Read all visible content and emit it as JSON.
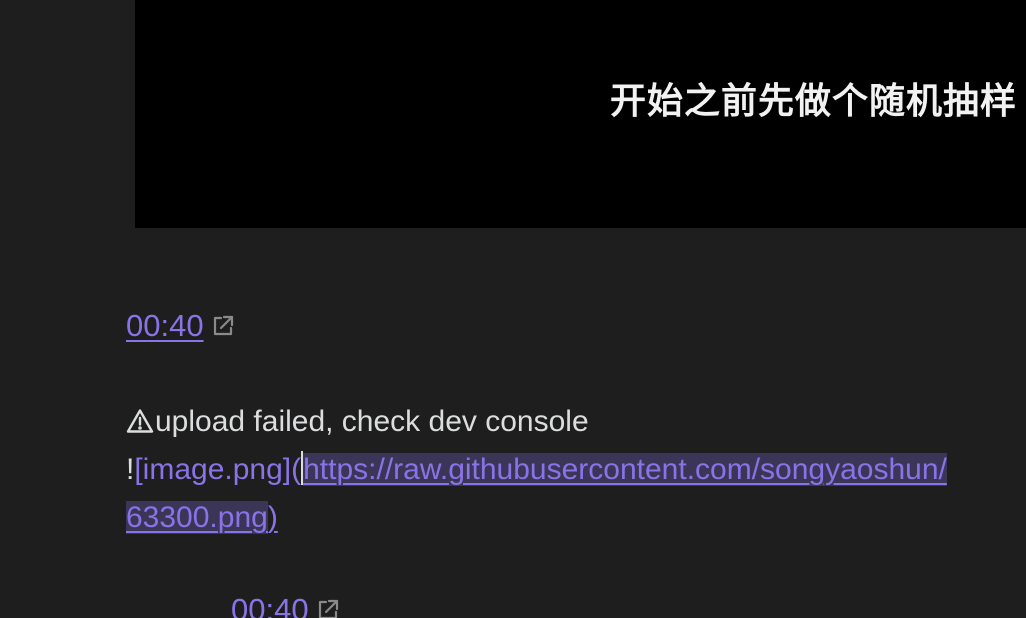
{
  "video": {
    "subtitle": "开始之前先做个随机抽样"
  },
  "timestamp1": {
    "label": "00:40",
    "icon": "external-link-icon"
  },
  "upload_error": {
    "icon": "warning-triangle-icon",
    "message": "upload failed, check dev console"
  },
  "image_markdown": {
    "bang": "!",
    "alt_text": "[image.png]",
    "open_paren": "(",
    "url_line1": "https://raw.githubusercontent.com/songyaoshun/",
    "url_line2": "63300.png",
    "close_paren": ")"
  },
  "timestamp2": {
    "label": "00:40",
    "icon": "external-link-icon"
  },
  "colors": {
    "background": "#1e1e1e",
    "link": "#8a73e6",
    "text": "#dcddde",
    "selection": "#3b3657",
    "video_bg": "#000000"
  }
}
